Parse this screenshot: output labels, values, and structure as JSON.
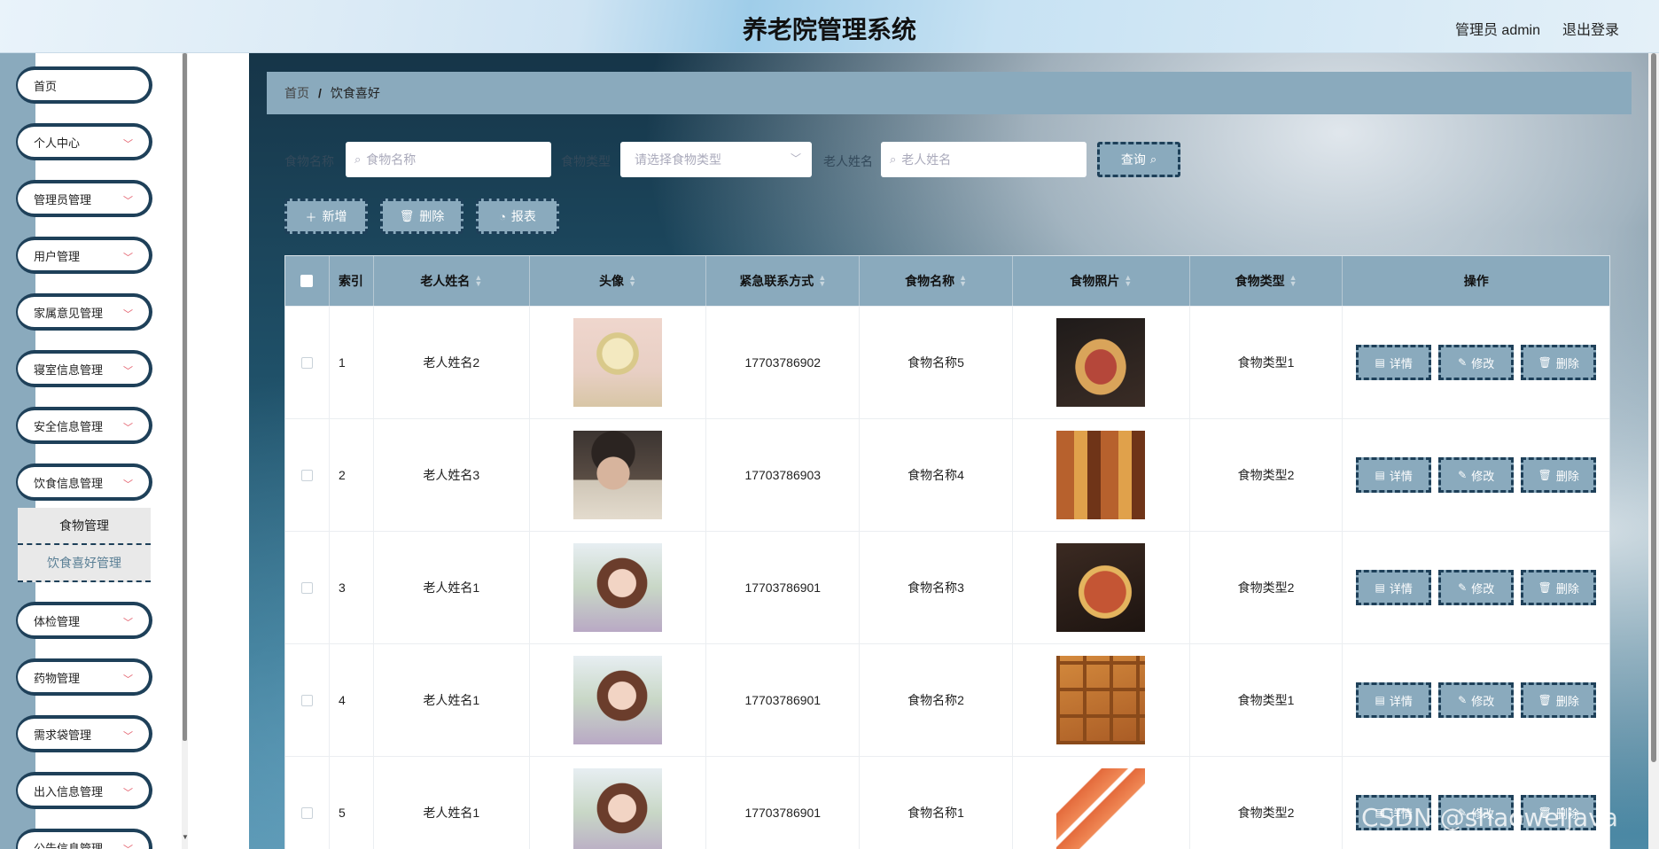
{
  "header": {
    "title": "养老院管理系统",
    "user": "管理员 admin",
    "logout": "退出登录"
  },
  "sidebar": {
    "items": [
      {
        "label": "首页",
        "chevron": false
      },
      {
        "label": "个人中心",
        "chevron": true
      },
      {
        "label": "管理员管理",
        "chevron": true
      },
      {
        "label": "用户管理",
        "chevron": true
      },
      {
        "label": "家属意见管理",
        "chevron": true
      },
      {
        "label": "寝室信息管理",
        "chevron": true
      },
      {
        "label": "安全信息管理",
        "chevron": true
      },
      {
        "label": "饮食信息管理",
        "chevron": true
      }
    ],
    "submenu": [
      "食物管理",
      "饮食喜好管理"
    ],
    "items_after": [
      {
        "label": "体检管理",
        "chevron": true
      },
      {
        "label": "药物管理",
        "chevron": true
      },
      {
        "label": "需求袋管理",
        "chevron": true
      },
      {
        "label": "出入信息管理",
        "chevron": true
      },
      {
        "label": "公告信息管理",
        "chevron": true
      }
    ]
  },
  "breadcrumb": {
    "home": "首页",
    "sep": "/",
    "current": "饮食喜好"
  },
  "search": {
    "food_name_label": "食物名称",
    "food_name_placeholder": "食物名称",
    "food_type_label": "食物类型",
    "food_type_placeholder": "请选择食物类型",
    "elder_name_label": "老人姓名",
    "elder_name_placeholder": "老人姓名",
    "query": "查询"
  },
  "actions": {
    "add": "新增",
    "delete": "删除",
    "report": "报表"
  },
  "table": {
    "headers": [
      "索引",
      "老人姓名",
      "头像",
      "紧急联系方式",
      "食物名称",
      "食物照片",
      "食物类型",
      "操作"
    ],
    "rows": [
      {
        "index": "1",
        "elder": "老人姓名2",
        "phone": "17703786902",
        "food": "食物名称5",
        "type": "食物类型1"
      },
      {
        "index": "2",
        "elder": "老人姓名3",
        "phone": "17703786903",
        "food": "食物名称4",
        "type": "食物类型2"
      },
      {
        "index": "3",
        "elder": "老人姓名1",
        "phone": "17703786901",
        "food": "食物名称3",
        "type": "食物类型2"
      },
      {
        "index": "4",
        "elder": "老人姓名1",
        "phone": "17703786901",
        "food": "食物名称2",
        "type": "食物类型1"
      },
      {
        "index": "5",
        "elder": "老人姓名1",
        "phone": "17703786901",
        "food": "食物名称1",
        "type": "食物类型2"
      }
    ],
    "row_buttons": {
      "detail": "详情",
      "edit": "修改",
      "delete": "删除"
    }
  },
  "watermark": "CSDN @shaoweijava",
  "colors": {
    "accent": "#8aaabd",
    "border_dark": "#1e4059",
    "chevron": "#e35d6a"
  }
}
